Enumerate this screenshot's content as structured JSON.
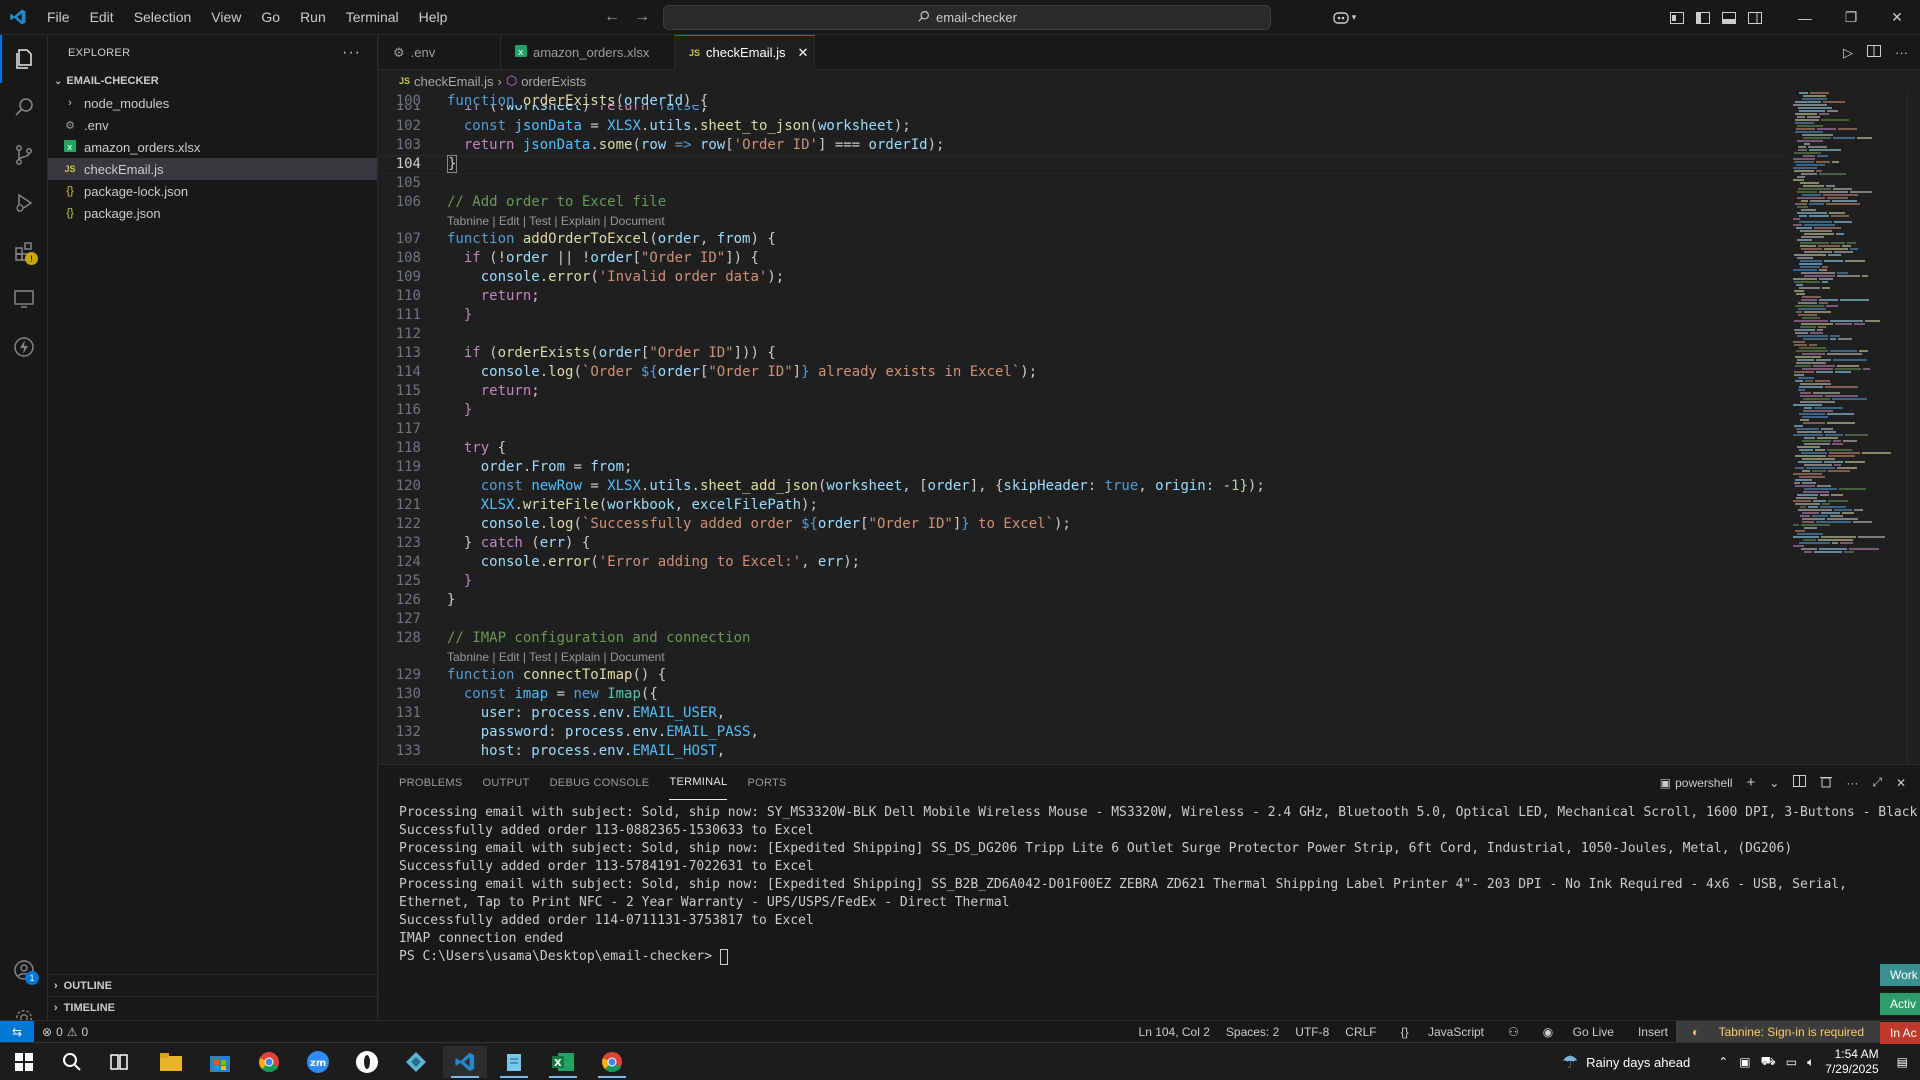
{
  "titlebar": {
    "menu": [
      "File",
      "Edit",
      "Selection",
      "View",
      "Go",
      "Run",
      "Terminal",
      "Help"
    ],
    "search_text": "email-checker"
  },
  "explorer": {
    "title": "EXPLORER",
    "folder": "EMAIL-CHECKER",
    "items": [
      {
        "label": "node_modules",
        "icon": "chevron-right-icon"
      },
      {
        "label": ".env",
        "icon": "gear-icon"
      },
      {
        "label": "amazon_orders.xlsx",
        "icon": "excel-file-icon"
      },
      {
        "label": "checkEmail.js",
        "icon": "js-file-icon"
      },
      {
        "label": "package-lock.json",
        "icon": "json-file-icon"
      },
      {
        "label": "package.json",
        "icon": "json-file-icon"
      }
    ],
    "outline": "OUTLINE",
    "timeline": "TIMELINE"
  },
  "tabs": [
    {
      "label": ".env",
      "icon": "gear-icon"
    },
    {
      "label": "amazon_orders.xlsx",
      "icon": "excel-file-icon"
    },
    {
      "label": "checkEmail.js",
      "icon": "js-file-icon"
    }
  ],
  "breadcrumb": {
    "file": "checkEmail.js",
    "symbol": "orderExists"
  },
  "editor": {
    "codelens": "Tabnine | Edit | Test | Explain | Document",
    "line_numbers": [
      "100",
      "101",
      "102",
      "103",
      "104",
      "105",
      "106",
      "107",
      "108",
      "109",
      "110",
      "111",
      "112",
      "113",
      "114",
      "115",
      "116",
      "117",
      "118",
      "119",
      "120",
      "121",
      "122",
      "123",
      "124",
      "125",
      "126",
      "127",
      "128",
      "129",
      "130",
      "131",
      "132",
      "133"
    ]
  },
  "panel": {
    "tabs": [
      "PROBLEMS",
      "OUTPUT",
      "DEBUG CONSOLE",
      "TERMINAL",
      "PORTS"
    ],
    "shell": "powershell",
    "terminal_lines": [
      "Processing email with subject: Sold, ship now: SY_MS3320W-BLK Dell Mobile Wireless Mouse - MS3320W, Wireless - 2.4 GHz, Bluetooth 5.0, Optical LED, Mechanical Scroll, 1600 DPI, 3-Buttons - Black",
      "Successfully added order 113-0882365-1530633 to Excel",
      "Processing email with subject: Sold, ship now: [Expedited Shipping] SS_DS_DG206 Tripp Lite 6 Outlet Surge Protector Power Strip, 6ft Cord, Industrial, 1050-Joules, Metal, (DG206)",
      "Successfully added order 113-5784191-7022631 to Excel",
      "Processing email with subject: Sold, ship now: [Expedited Shipping] SS_B2B_ZD6A042-D01F00EZ ZEBRA ZD621 Thermal Shipping Label Printer 4\"- 203 DPI - No Ink Required - 4x6 - USB, Serial, Ethernet, Tap to Print NFC - 2 Year Warranty - UPS/USPS/FedEx - Direct Thermal",
      "Successfully added order 114-0711131-3753817 to Excel",
      "IMAP connection ended"
    ],
    "prompt": "PS C:\\Users\\usama\\Desktop\\email-checker> "
  },
  "statusbar": {
    "errors": "0",
    "warnings": "0",
    "position": "Ln 104, Col 2",
    "spaces": "Spaces: 2",
    "encoding": "UTF-8",
    "eol": "CRLF",
    "language": "JavaScript",
    "golive": "Go Live",
    "mode": "Insert",
    "tabnine": "Tabnine: Sign-in is required"
  },
  "taskbar": {
    "weather": "Rainy days ahead",
    "time": "1:54 AM",
    "date": "7/29/2025"
  },
  "side_tags": [
    "Work",
    "Activ",
    "In Ac"
  ]
}
